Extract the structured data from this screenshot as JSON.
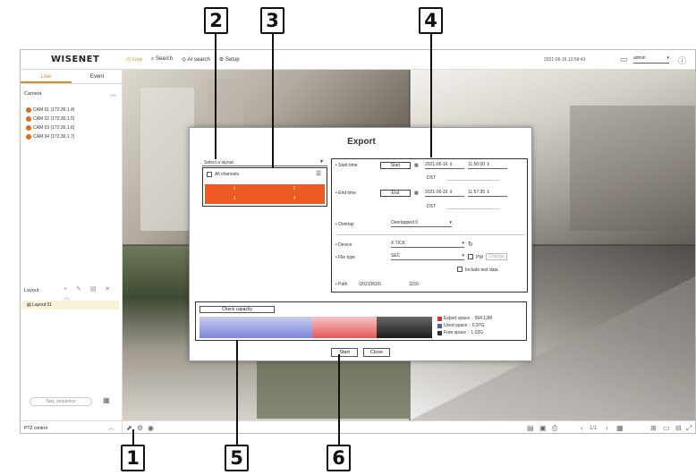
{
  "callouts": [
    "1",
    "2",
    "3",
    "4",
    "5",
    "6"
  ],
  "app": {
    "logo": "WISENET",
    "menu": {
      "live": "Live",
      "search": "Search",
      "ai_search": "AI search",
      "setup": "Setup"
    },
    "datetime": "2021-06-16 13:58:43",
    "user": "admin"
  },
  "sidebar": {
    "tabs": [
      "Live",
      "Event"
    ],
    "camera_header": "Camera",
    "cameras": [
      "CAM 01 (172.30.1.4)",
      "CAM 02 (172.30.1.5)",
      "CAM 03 (172.30.1.6)",
      "CAM 04 (172.30.1.7)"
    ],
    "layout_header": "Layout",
    "layouts": [
      "Layout 01"
    ],
    "sequence_button": "Seq. sequence",
    "ptz_control": "PTZ control"
  },
  "dialog": {
    "title": "Export",
    "select_layout": "Select a layout.",
    "all_channels": "All channels",
    "channels": [
      "1",
      "2",
      "3",
      "4"
    ],
    "start_time": {
      "label": "Start time",
      "button": "Start",
      "date": "2021-06-16",
      "time": "11:50:00",
      "dst": "DST"
    },
    "end_time": {
      "label": "End time",
      "button": "End",
      "date": "2021-06-16",
      "time": "11:57:35",
      "dst": "DST"
    },
    "overlap": {
      "label": "Overlap",
      "value": "Overlapped 0"
    },
    "device": {
      "label": "Device",
      "value": "X TICK"
    },
    "file_type": {
      "label": "File type",
      "value": "SEC",
      "pw_label": "PW",
      "pw_button": "Change"
    },
    "include_text_data": "Include text data",
    "path": {
      "label": "Path",
      "value": "\\20210616\\",
      "time": "1150"
    },
    "check_capacity": "Check capacity",
    "capacity_legend": [
      {
        "label": "Export space",
        "value": "564.13M",
        "color": "#e03030"
      },
      {
        "label": "Used space",
        "value": "0.97G",
        "color": "#4a5fc0"
      },
      {
        "label": "Free space",
        "value": "1.02G",
        "color": "#333333"
      }
    ],
    "start_button": "Start",
    "close_button": "Close"
  }
}
